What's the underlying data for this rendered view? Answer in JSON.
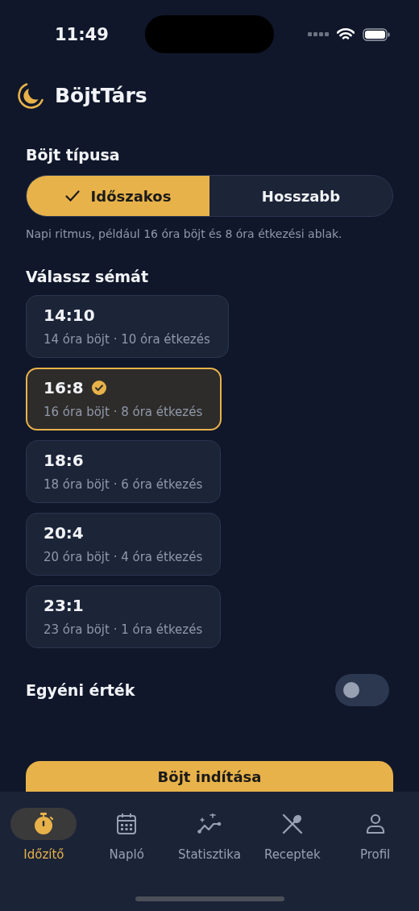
{
  "status_bar": {
    "time": "11:49"
  },
  "app": {
    "title": "BöjtTárs"
  },
  "fast_type": {
    "heading": "Böjt típusa",
    "options": [
      {
        "label": "Időszakos",
        "selected": true
      },
      {
        "label": "Hosszabb",
        "selected": false
      }
    ],
    "description": "Napi ritmus, például 16 óra böjt és 8 óra étkezési ablak."
  },
  "plans": {
    "heading": "Válassz sémát",
    "items": [
      {
        "ratio": "14:10",
        "detail": "14 óra böjt · 10 óra étkezés",
        "selected": false
      },
      {
        "ratio": "16:8",
        "detail": "16 óra böjt · 8 óra étkezés",
        "selected": true
      },
      {
        "ratio": "18:6",
        "detail": "18 óra böjt · 6 óra étkezés",
        "selected": false
      },
      {
        "ratio": "20:4",
        "detail": "20 óra böjt · 4 óra étkezés",
        "selected": false
      },
      {
        "ratio": "23:1",
        "detail": "23 óra böjt · 1 óra étkezés",
        "selected": false
      }
    ]
  },
  "custom_value": {
    "label": "Egyéni érték",
    "on": false
  },
  "start_button": {
    "label": "Böjt indítása"
  },
  "tab_bar": {
    "tabs": [
      {
        "label": "Időzítő",
        "selected": true
      },
      {
        "label": "Napló",
        "selected": false
      },
      {
        "label": "Statisztika",
        "selected": false
      },
      {
        "label": "Receptek",
        "selected": false
      },
      {
        "label": "Profil",
        "selected": false
      }
    ]
  }
}
